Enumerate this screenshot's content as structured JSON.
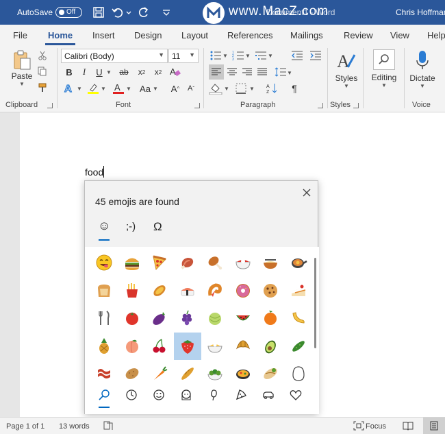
{
  "titlebar": {
    "autosave_label": "AutoSave",
    "autosave_state": "Off",
    "document_title": "Document1 - Word",
    "watermark": "www.MacZ.com",
    "user": "Chris Hoffman"
  },
  "tabs": [
    "File",
    "Home",
    "Insert",
    "Design",
    "Layout",
    "References",
    "Mailings",
    "Review",
    "View",
    "Help"
  ],
  "active_tab": "Home",
  "ribbon": {
    "clipboard": {
      "label": "Clipboard",
      "paste_label": "Paste"
    },
    "font": {
      "label": "Font",
      "font_name": "Calibri (Body)",
      "font_size": "11",
      "case_label": "Aa"
    },
    "paragraph": {
      "label": "Paragraph"
    },
    "styles": {
      "label": "Styles",
      "button_label": "Styles"
    },
    "editing": {
      "button_label": "Editing"
    },
    "voice": {
      "label": "Voice",
      "button_label": "Dictate"
    }
  },
  "document": {
    "text": "food"
  },
  "emoji_panel": {
    "header": "45 emojis are found",
    "tabs": [
      {
        "name": "emoji",
        "label": "☺"
      },
      {
        "name": "kaomoji",
        "label": ";-)"
      },
      {
        "name": "symbols",
        "label": "Ω"
      }
    ],
    "emojis": [
      "smiling-face-savoring-food",
      "hamburger",
      "pizza",
      "meat-on-bone",
      "poultry-leg",
      "bento-box",
      "steaming-bowl",
      "shallow-pan-of-food",
      "bread",
      "french-fries",
      "sweet-potato",
      "sushi",
      "fried-shrimp",
      "doughnut",
      "cookie",
      "shortcake",
      "fork-and-knife",
      "tomato",
      "eggplant",
      "grapes",
      "melon",
      "watermelon",
      "tangerine",
      "banana",
      "pineapple",
      "peach",
      "cherries",
      "strawberry",
      "salad",
      "croissant",
      "avocado",
      "cucumber",
      "bacon",
      "potato",
      "carrot",
      "baguette",
      "green-salad",
      "paella",
      "burrito",
      "egg"
    ],
    "highlighted_index": 27,
    "categories": [
      "search-icon",
      "recent-icon",
      "smiley-icon",
      "people-icon",
      "celebration-icon",
      "food-icon",
      "travel-icon",
      "heart-icon"
    ]
  },
  "statusbar": {
    "page": "Page 1 of 1",
    "words": "13 words",
    "focus_label": "Focus"
  }
}
